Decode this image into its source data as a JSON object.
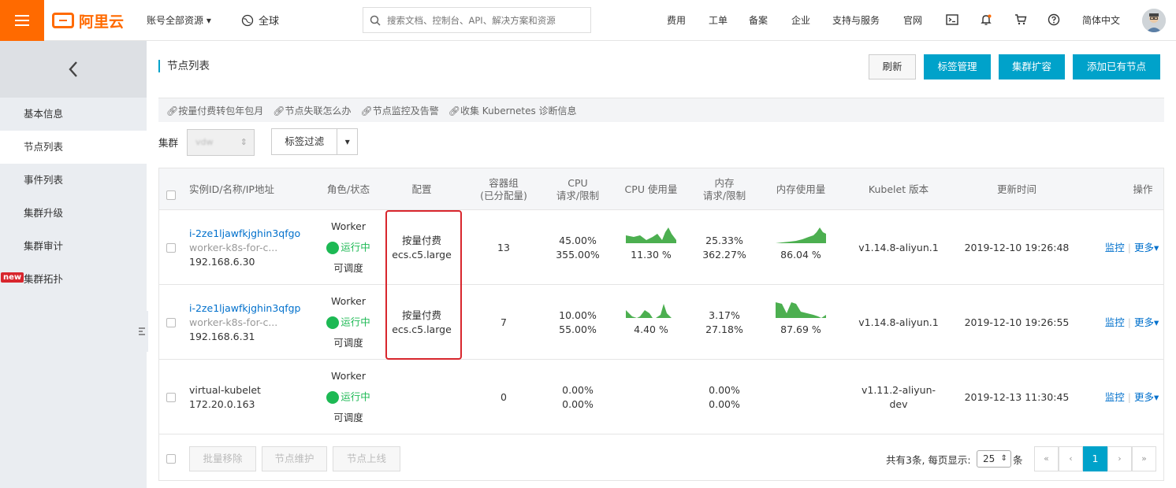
{
  "topbar": {
    "logo_text": "阿里云",
    "account_resources": "账号全部资源",
    "region": "全球",
    "search_placeholder": "搜索文档、控制台、API、解决方案和资源",
    "nav": [
      "费用",
      "工单",
      "备案",
      "企业",
      "支持与服务",
      "官网"
    ],
    "language": "简体中文"
  },
  "sidebar": {
    "items": [
      {
        "label": "基本信息",
        "active": false
      },
      {
        "label": "节点列表",
        "active": true
      },
      {
        "label": "事件列表",
        "active": false
      },
      {
        "label": "集群升级",
        "active": false
      },
      {
        "label": "集群审计",
        "active": false
      },
      {
        "label": "集群拓扑",
        "active": false,
        "badge": "new"
      }
    ]
  },
  "page": {
    "title": "节点列表",
    "buttons": {
      "refresh": "刷新",
      "tag_manage": "标签管理",
      "scale_out": "集群扩容",
      "add_existing": "添加已有节点"
    },
    "help_links": [
      "按量付费转包年包月",
      "节点失联怎么办",
      "节点监控及告警",
      "收集 Kubernetes 诊断信息"
    ],
    "filter": {
      "cluster_label": "集群",
      "cluster_value": "vdw",
      "tag_filter": "标签过滤"
    }
  },
  "table": {
    "headers": {
      "instance": "实例ID/名称/IP地址",
      "role": "角色/状态",
      "config": "配置",
      "pods": [
        "容器组",
        "(已分配量)"
      ],
      "cpu_req": [
        "CPU",
        "请求/限制"
      ],
      "cpu_usage": "CPU 使用量",
      "mem_req": [
        "内存",
        "请求/限制"
      ],
      "mem_usage": "内存使用量",
      "kubelet": "Kubelet 版本",
      "updated": "更新时间",
      "actions": "操作"
    },
    "rows": [
      {
        "id": "i-2ze1ljawfkjghin3qfgo",
        "name": "worker-k8s-for-c...",
        "ip": "192.168.6.30",
        "role": "Worker",
        "status": "运行中",
        "schedulable": "可调度",
        "billing": "按量付费",
        "type": "ecs.c5.large",
        "pods": "13",
        "cpu_req": "45.00%",
        "cpu_limit": "355.00%",
        "cpu_usage": "11.30 %",
        "mem_req": "25.33%",
        "mem_limit": "362.27%",
        "mem_usage": "86.04 %",
        "kubelet": "v1.14.8-aliyun.1",
        "updated": "2019-12-10 19:26:48",
        "monitor": "监控",
        "more": "更多"
      },
      {
        "id": "i-2ze1ljawfkjghin3qfgp",
        "name": "worker-k8s-for-c...",
        "ip": "192.168.6.31",
        "role": "Worker",
        "status": "运行中",
        "schedulable": "可调度",
        "billing": "按量付费",
        "type": "ecs.c5.large",
        "pods": "7",
        "cpu_req": "10.00%",
        "cpu_limit": "55.00%",
        "cpu_usage": "4.40 %",
        "mem_req": "3.17%",
        "mem_limit": "27.18%",
        "mem_usage": "87.69 %",
        "kubelet": "v1.14.8-aliyun.1",
        "updated": "2019-12-10 19:26:55",
        "monitor": "监控",
        "more": "更多"
      },
      {
        "name": "virtual-kubelet",
        "ip": "172.20.0.163",
        "role": "Worker",
        "status": "运行中",
        "schedulable": "可调度",
        "pods": "0",
        "cpu_req": "0.00%",
        "cpu_limit": "0.00%",
        "mem_req": "0.00%",
        "mem_limit": "0.00%",
        "kubelet": "v1.11.2-aliyun-dev",
        "updated": "2019-12-13 11:30:45",
        "monitor": "监控",
        "more": "更多"
      }
    ],
    "footer": {
      "batch_remove": "批量移除",
      "maintain": "节点维护",
      "online": "节点上线",
      "summary": "共有3条, 每页显示:",
      "page_size": "25",
      "unit": "条",
      "current_page": "1"
    }
  },
  "colors": {
    "brand": "#ff6a00",
    "primary": "#00a2ca",
    "link": "#0070cc",
    "running": "#1db954",
    "highlight": "#d8262d",
    "sparkline": "#4caf50"
  }
}
